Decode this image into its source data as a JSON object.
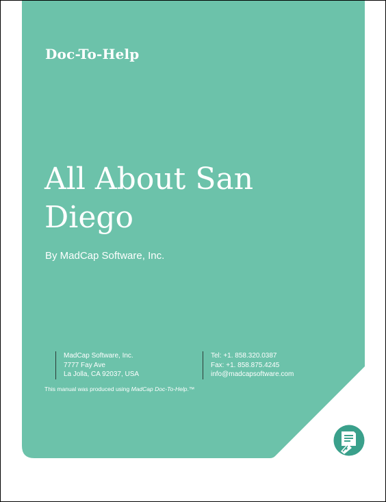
{
  "cover": {
    "brand": "Doc-To-Help",
    "title": "All About San Diego",
    "byline": "By MadCap Software, Inc.",
    "panel_color": "#6cc2aa"
  },
  "contact": {
    "address": [
      "MadCap Software, Inc.",
      "7777 Fay Ave",
      "La Jolla, CA 92037, USA"
    ],
    "phone": [
      "Tel: +1. 858.320.0387",
      "Fax: +1. 858.875.4245",
      "info@madcapsoftware.com"
    ]
  },
  "produced": {
    "prefix": "This manual was produced using ",
    "product": "MadCap Doc-To-Help",
    "suffix": ".™"
  },
  "logo": {
    "icon": "doc-to-help-logo-icon"
  }
}
